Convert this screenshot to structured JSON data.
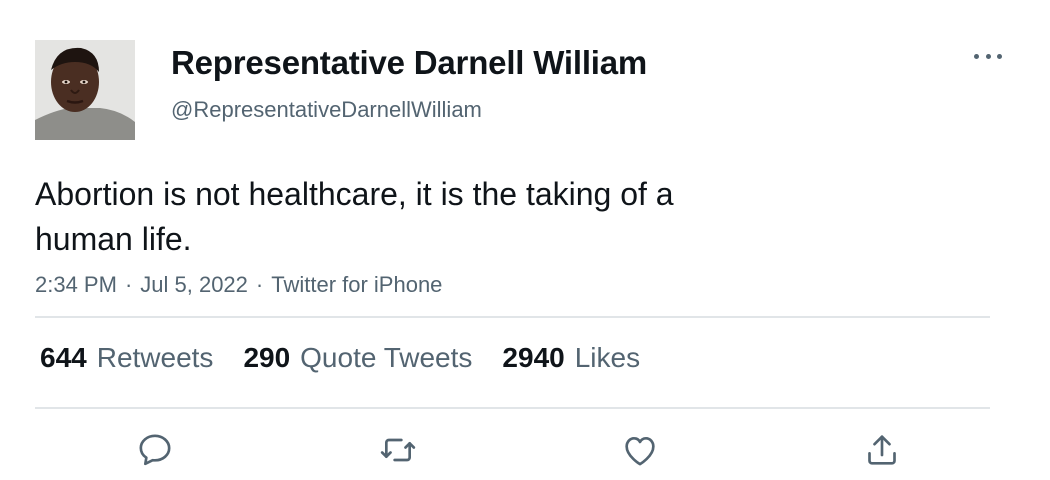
{
  "author": {
    "display_name": "Representative Darnell William",
    "handle": "@RepresentativeDarnellWilliam",
    "avatar": "profile-photo"
  },
  "tweet": {
    "text_line1": "Abortion is not healthcare, it is the taking of a",
    "text_line2": "human life."
  },
  "meta": {
    "time": "2:34 PM",
    "separator": "·",
    "date": "Jul 5, 2022",
    "source": "Twitter for iPhone"
  },
  "stats": {
    "retweets": {
      "count": "644",
      "label": "Retweets"
    },
    "quote_tweets": {
      "count": "290",
      "label": "Quote Tweets"
    },
    "likes": {
      "count": "2940",
      "label": "Likes"
    }
  },
  "actions": [
    "reply-icon",
    "retweet-icon",
    "like-icon",
    "share-icon"
  ],
  "colors": {
    "text_primary": "#0f1419",
    "text_secondary": "#536471",
    "divider": "#e1e5e8",
    "icon": "#536471"
  }
}
